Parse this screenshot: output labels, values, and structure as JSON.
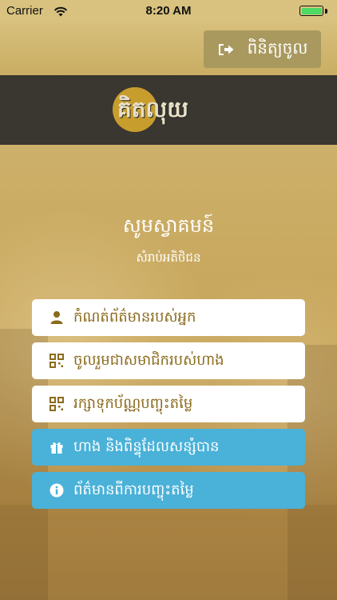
{
  "status_bar": {
    "carrier": "Carrier",
    "time": "8:20 AM"
  },
  "header": {
    "login_label": "ពិនិត្យចូល"
  },
  "logo": {
    "text": "គិតលុយ"
  },
  "welcome": {
    "title": "សូមស្វាគមន៍",
    "subtitle": "សំរាប់អតិថិជន"
  },
  "menu": [
    {
      "label": "កំណត់ព័ត៌មានរបស់អ្នក",
      "icon": "user-icon",
      "style": "light"
    },
    {
      "label": "ចូលរួមជាសមាជិករបស់ហាង",
      "icon": "qr-code-icon",
      "style": "light"
    },
    {
      "label": "រក្សាទុកប័ណ្ណបញ្ចុះតម្លៃ",
      "icon": "qr-code-icon",
      "style": "light"
    },
    {
      "label": "ហាង និងពិន្ទុដែលសន្សំបាន",
      "icon": "gift-icon",
      "style": "blue"
    },
    {
      "label": "ព័ត៌មានពីការបញ្ចុះតម្លៃ",
      "icon": "info-icon",
      "style": "blue"
    }
  ],
  "colors": {
    "gold": "#c9aa62",
    "logo_band": "#3a3630",
    "login_button": "#a9995f",
    "blue_button": "#4ab1d8",
    "light_button_text": "#8a6a1c",
    "battery": "#4cd964"
  }
}
